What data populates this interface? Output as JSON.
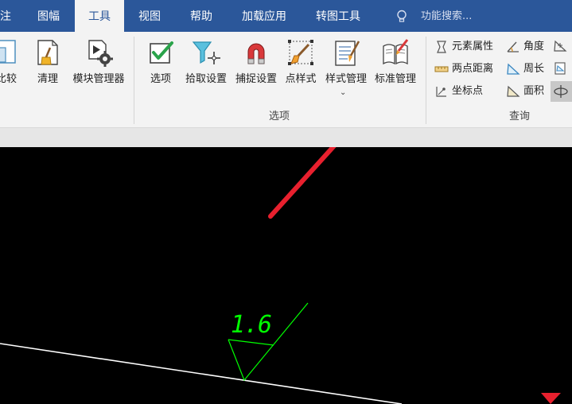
{
  "menu": {
    "tabs": [
      {
        "label": "注"
      },
      {
        "label": "图幅"
      },
      {
        "label": "工具",
        "active": true
      },
      {
        "label": "视图"
      },
      {
        "label": "帮助"
      },
      {
        "label": "加载应用"
      },
      {
        "label": "转图工具"
      }
    ],
    "search_placeholder": "功能搜索..."
  },
  "ribbon": {
    "tools": [
      {
        "label": "比较",
        "icon": "compare-icon"
      },
      {
        "label": "清理",
        "icon": "broom-icon"
      },
      {
        "label": "模块管理器",
        "icon": "module-gear-icon"
      },
      {
        "label": "选项",
        "icon": "checkbox-icon"
      },
      {
        "label": "拾取设置",
        "icon": "funnel-pick-icon"
      },
      {
        "label": "捕捉设置",
        "icon": "magnet-icon"
      },
      {
        "label": "点样式",
        "icon": "point-brush-icon"
      },
      {
        "label": "样式管理",
        "icon": "style-doc-icon"
      },
      {
        "label": "标准管理",
        "icon": "book-pen-icon"
      }
    ],
    "options_group_label": "选项",
    "query_group_label": "查询",
    "query_items": [
      {
        "label": "元素属性",
        "icon": "element-props-icon"
      },
      {
        "label": "两点距离",
        "icon": "ruler-icon"
      },
      {
        "label": "坐标点",
        "icon": "coordinate-icon"
      },
      {
        "label": "角度",
        "icon": "angle-icon"
      },
      {
        "label": "周长",
        "icon": "perimeter-icon"
      },
      {
        "label": "面积",
        "icon": "area-icon"
      }
    ]
  },
  "drawing": {
    "roughness_value": "1.6",
    "line_color": "#ffffff",
    "symbol_color": "#00ff00",
    "arrow_color": "#e8202e"
  }
}
